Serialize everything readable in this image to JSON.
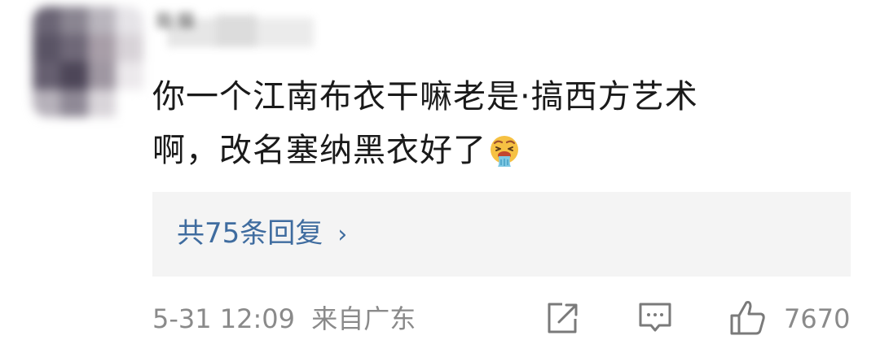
{
  "comment": {
    "username_blurred": "能猫",
    "lines": [
      "你一个江南布衣干嘛老是·搞西方艺术",
      "啊，改名塞纳黑衣好了"
    ],
    "emoji": "vomiting-face-icon"
  },
  "replies": {
    "label": "共75条回复",
    "chevron": "›"
  },
  "meta": {
    "timestamp": "5-31 12:09",
    "location": "来自广东"
  },
  "actions": {
    "share_icon": "share-icon",
    "reply_icon": "comment-icon",
    "like_icon": "thumbs-up-icon",
    "like_count": "7670"
  },
  "colors": {
    "link": "#3f6c9f",
    "meta": "#8a8a8a",
    "reply_bg": "#f4f4f4",
    "text": "#1a1a1a"
  }
}
